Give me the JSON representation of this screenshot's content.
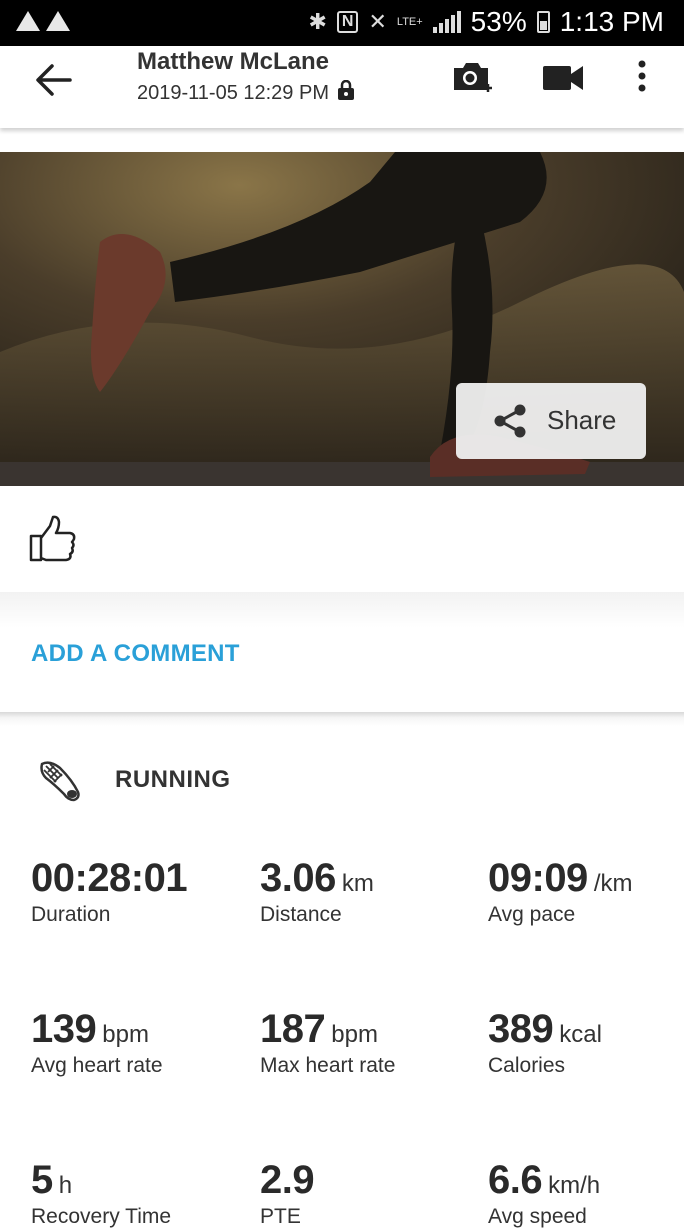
{
  "status_bar": {
    "battery": "53%",
    "time": "1:13 PM",
    "network": "LTE+"
  },
  "header": {
    "title": "Matthew McLane",
    "subtitle": "2019-11-05 12:29 PM"
  },
  "hero": {
    "share_label": "Share"
  },
  "comment": {
    "add_label": "ADD A COMMENT"
  },
  "activity": {
    "name": "RUNNING"
  },
  "stats": [
    {
      "value": "00:28:01",
      "unit": "",
      "label": "Duration"
    },
    {
      "value": "3.06",
      "unit": "km",
      "label": "Distance"
    },
    {
      "value": "09:09",
      "unit": "/km",
      "label": "Avg pace"
    },
    {
      "value": "139",
      "unit": "bpm",
      "label": "Avg heart rate"
    },
    {
      "value": "187",
      "unit": "bpm",
      "label": "Max heart rate"
    },
    {
      "value": "389",
      "unit": "kcal",
      "label": "Calories"
    },
    {
      "value": "5",
      "unit": "h",
      "label": "Recovery Time"
    },
    {
      "value": "2.9",
      "unit": "",
      "label": "PTE"
    },
    {
      "value": "6.6",
      "unit": "km/h",
      "label": "Avg speed"
    }
  ],
  "icons": {
    "back": "arrow-left-icon",
    "add_photo": "camera-plus-icon",
    "video": "video-camera-icon",
    "more": "more-vert-icon",
    "lock": "lock-icon",
    "share": "share-icon",
    "like": "thumbs-up-icon",
    "activity": "running-shoe-icon"
  }
}
